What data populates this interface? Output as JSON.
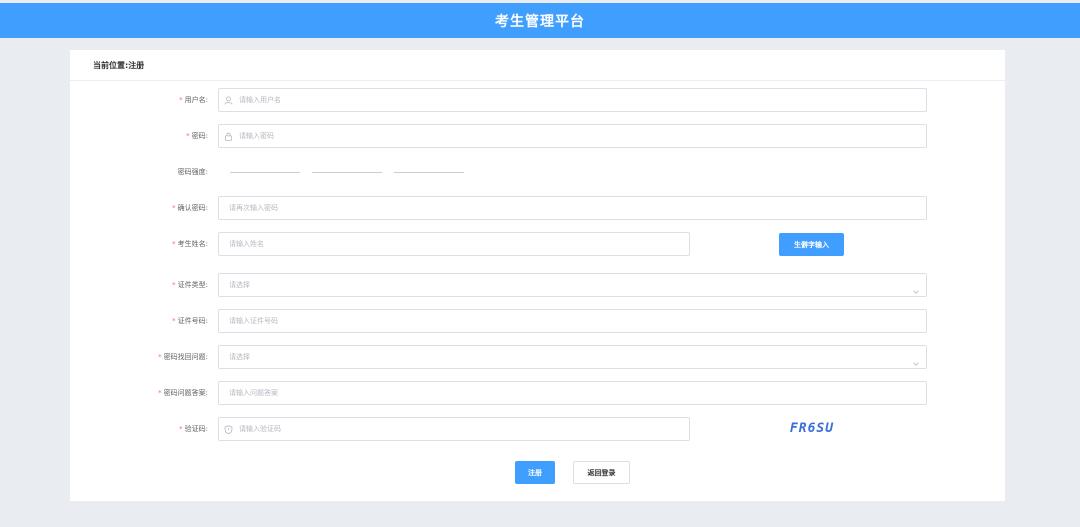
{
  "app": {
    "title": "考生管理平台"
  },
  "breadcrumb": {
    "prefix": "当前位置:",
    "current": "注册"
  },
  "form": {
    "username": {
      "label": "用户名:",
      "placeholder": "请输入用户名"
    },
    "password": {
      "label": "密码:",
      "placeholder": "请输入密码"
    },
    "strength": {
      "label": "密码强度:"
    },
    "confirm": {
      "label": "确认密码:",
      "placeholder": "请再次输入密码"
    },
    "name": {
      "label": "考生姓名:",
      "placeholder": "请输入姓名",
      "rare_button": "生僻字输入"
    },
    "id_type": {
      "label": "证件类型:",
      "placeholder": "请选择"
    },
    "id_number": {
      "label": "证件号码:",
      "placeholder": "请输入证件号码"
    },
    "question": {
      "label": "密码找回问题:",
      "placeholder": "请选择"
    },
    "answer": {
      "label": "密码问题答案:",
      "placeholder": "请输入问题答案"
    },
    "captcha": {
      "label": "验证码:",
      "placeholder": "请输入验证码",
      "code": "FR6SU"
    }
  },
  "actions": {
    "register": "注册",
    "back_login": "返回登录"
  },
  "colors": {
    "primary": "#409eff",
    "required": "#f56c6c",
    "background": "#e9edf2"
  },
  "icons": [
    "user-icon",
    "lock-icon",
    "chevron-down-icon",
    "shield-icon"
  ]
}
